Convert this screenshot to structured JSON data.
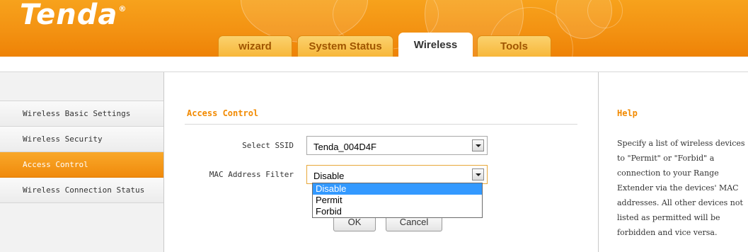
{
  "brand": {
    "logo_text": "Tenda",
    "logo_mark": "®"
  },
  "nav": {
    "tabs": [
      {
        "label": "wizard",
        "active": false
      },
      {
        "label": "System Status",
        "active": false
      },
      {
        "label": "Wireless",
        "active": true
      },
      {
        "label": "Tools",
        "active": false
      }
    ]
  },
  "sidebar": {
    "items": [
      {
        "label": "Wireless Basic Settings",
        "active": false
      },
      {
        "label": "Wireless Security",
        "active": false
      },
      {
        "label": "Access Control",
        "active": true
      },
      {
        "label": "Wireless Connection Status",
        "active": false
      }
    ]
  },
  "main": {
    "title": "Access Control",
    "ssid": {
      "label": "Select SSID",
      "value": "Tenda_004D4F"
    },
    "mac_filter": {
      "label": "MAC Address Filter",
      "value": "Disable",
      "options": [
        "Disable",
        "Permit",
        "Forbid"
      ],
      "highlighted": "Disable"
    },
    "buttons": {
      "ok": "OK",
      "cancel": "Cancel"
    }
  },
  "help": {
    "title": "Help",
    "text": "Specify a list of wireless devices to \"Permit\" or \"Forbid\" a connection to your Range Extender via the devices' MAC addresses. All other devices not listed as permitted will be forbidden and vice versa."
  },
  "colors": {
    "header_orange": "#f39212",
    "accent_orange": "#f28a00",
    "active_sidebar": "#f08a0c",
    "dropdown_highlight": "#3399ff"
  }
}
